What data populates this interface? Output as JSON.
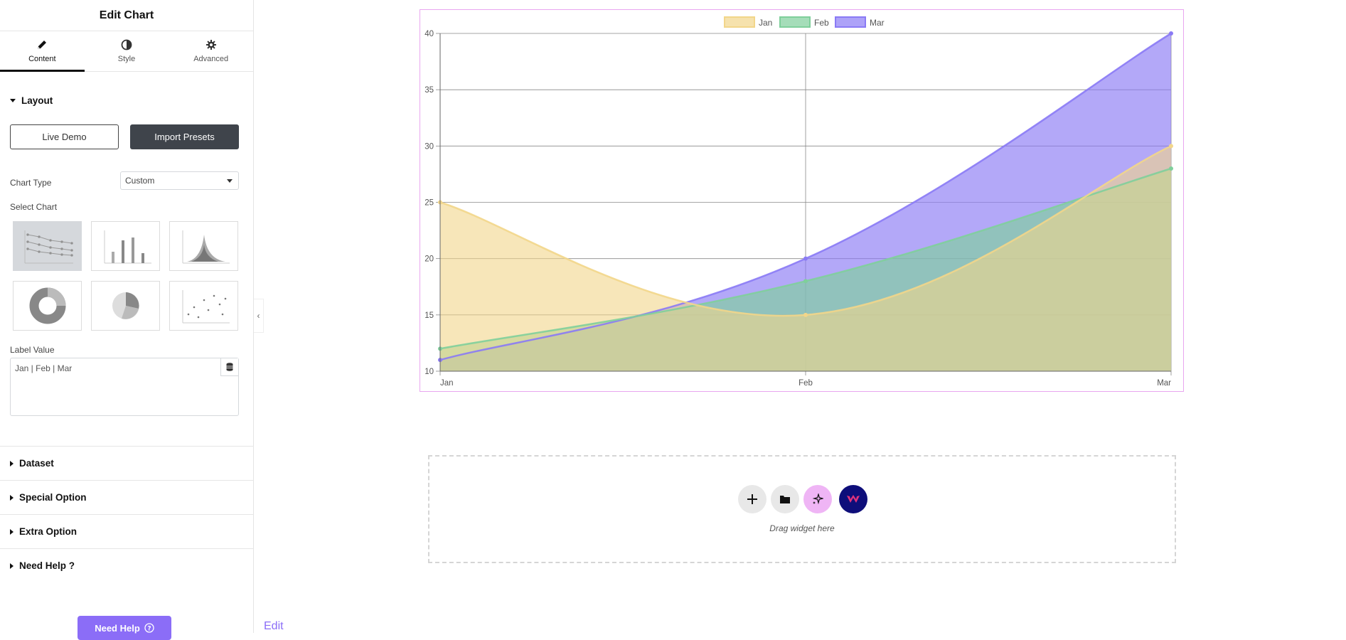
{
  "panel": {
    "title": "Edit Chart",
    "tabs": [
      {
        "label": "Content",
        "icon": "pencil-icon",
        "active": true
      },
      {
        "label": "Style",
        "icon": "contrast-icon",
        "active": false
      },
      {
        "label": "Advanced",
        "icon": "gear-icon",
        "active": false
      }
    ],
    "layout": {
      "heading": "Layout",
      "live_demo_label": "Live Demo",
      "import_presets_label": "Import Presets",
      "chart_type_label": "Chart Type",
      "chart_type_value": "Custom",
      "select_chart_label": "Select Chart",
      "chart_options": [
        "line",
        "bar",
        "area",
        "doughnut",
        "pie",
        "scatter"
      ],
      "selected_chart": "line",
      "label_value_label": "Label Value",
      "label_value": "Jan | Feb | Mar"
    },
    "sections": [
      "Dataset",
      "Special Option",
      "Extra Option",
      "Need Help ?"
    ],
    "need_help_button": "Need Help"
  },
  "canvas": {
    "drop_zone_text": "Drag widget here",
    "edit_link": "Edit"
  },
  "colors": {
    "accent": "#8b6df7",
    "jan": "#f2d68a",
    "feb": "#7fcf9b",
    "mar": "#8a7af5"
  },
  "chart_data": {
    "type": "area",
    "categories": [
      "Jan",
      "Feb",
      "Mar"
    ],
    "series": [
      {
        "name": "Jan",
        "values": [
          25,
          15,
          30
        ]
      },
      {
        "name": "Feb",
        "values": [
          12,
          18,
          28
        ]
      },
      {
        "name": "Mar",
        "values": [
          11,
          20,
          40
        ]
      }
    ],
    "ylim": [
      10,
      40
    ],
    "yticks": [
      10,
      15,
      20,
      25,
      30,
      35,
      40
    ],
    "grid": true,
    "legend": "top-center"
  }
}
